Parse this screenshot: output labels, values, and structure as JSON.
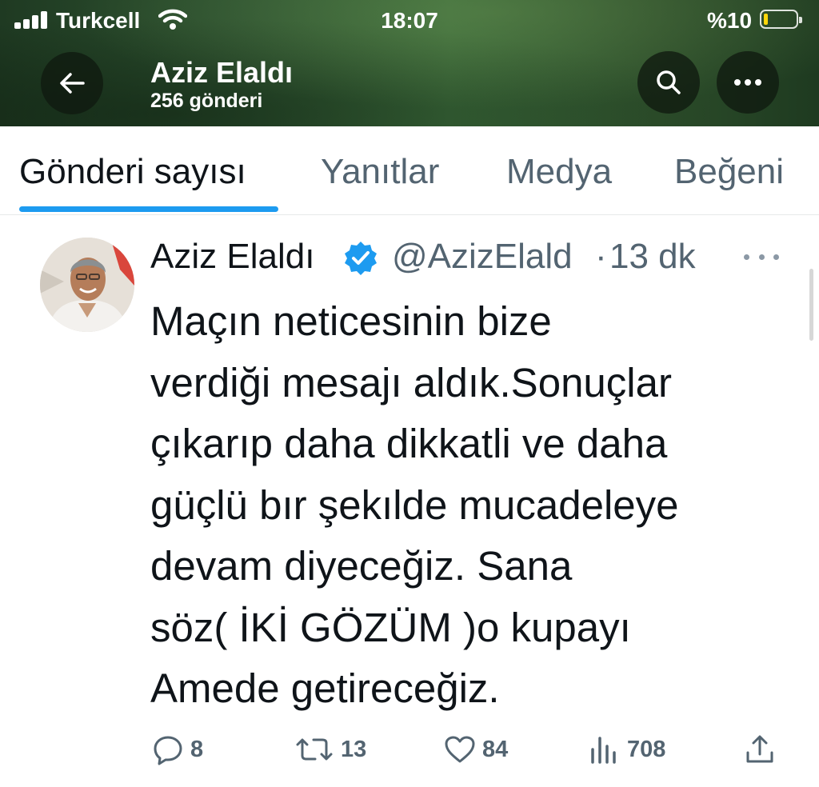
{
  "status_bar": {
    "carrier": "Turkcell",
    "time": "18:07",
    "battery": "%10"
  },
  "header": {
    "name": "Aziz Elaldı",
    "post_count": "256 gönderi"
  },
  "tabs": [
    {
      "label": "Gönderi sayısı",
      "active": true
    },
    {
      "label": "Yanıtlar",
      "active": false
    },
    {
      "label": "Medya",
      "active": false
    },
    {
      "label": "Beğeni",
      "active": false
    }
  ],
  "tweet": {
    "author": "Aziz Elaldı",
    "handle": "@AzizElald",
    "separator": "·",
    "time": "13 dk",
    "lines": [
      "Maçın neticesinin bize",
      "verdiği mesajı aldık.Sonuçlar",
      "çıkarıp daha dikkatli ve daha",
      "güçlü bır şekılde mucadeleye",
      "devam diyeceğiz. Sana",
      "söz( İKİ GÖZÜM )o kupayı",
      "Amede getireceğiz."
    ],
    "replies": "8",
    "retweets": "13",
    "likes": "84",
    "views": "708"
  },
  "colors": {
    "accent": "#1d9bf0",
    "secondary_text": "#536471",
    "primary_text": "#0f1419",
    "header_green": "#2d5230"
  },
  "icons": [
    "back-arrow-icon",
    "search-icon",
    "more-icon",
    "verified-badge-icon",
    "reply-icon",
    "retweet-icon",
    "like-icon",
    "views-icon",
    "share-icon"
  ]
}
